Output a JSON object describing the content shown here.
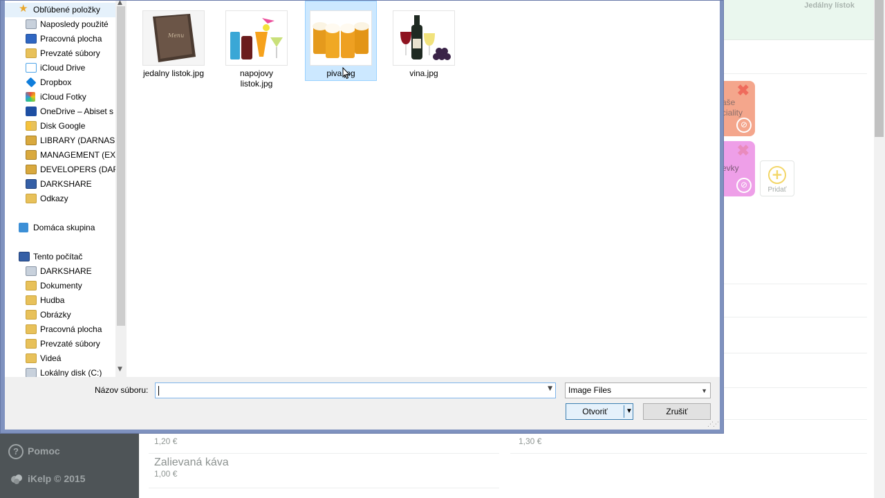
{
  "background_app": {
    "menu_title": "Jedálny lístok",
    "categories": [
      {
        "label": "aše\nciality",
        "color": "#f4a68c"
      },
      {
        "label": "evky",
        "color": "#ee9fe8"
      }
    ],
    "add_label": "Pridať",
    "help_label": "Pomoc",
    "copyright": "iKelp © 2015",
    "items": [
      {
        "name": "",
        "price": "1,20 €"
      },
      {
        "name": "",
        "price": "1,30 €"
      },
      {
        "name": "Zalievaná káva",
        "price": "1,00 €"
      }
    ]
  },
  "dialog": {
    "nav_items": [
      {
        "label": "Obľúbené položky",
        "icon": "star-icon"
      },
      {
        "label": "Naposledy použité",
        "icon": "recent-places-icon"
      },
      {
        "label": "Pracovná plocha",
        "icon": "desktop-icon"
      },
      {
        "label": "Prevzaté súbory",
        "icon": "downloads-folder-icon"
      },
      {
        "label": "iCloud Drive",
        "icon": "icloud-icon"
      },
      {
        "label": "Dropbox",
        "icon": "dropbox-icon"
      },
      {
        "label": "iCloud Fotky",
        "icon": "photos-icon"
      },
      {
        "label": "OneDrive – Abiset s",
        "icon": "onedrive-icon"
      },
      {
        "label": "Disk Google",
        "icon": "google-drive-folder-icon"
      },
      {
        "label": "LIBRARY (DARNASS",
        "icon": "network-folder-icon"
      },
      {
        "label": "MANAGEMENT (EX",
        "icon": "network-folder-icon"
      },
      {
        "label": "DEVELOPERS (DARN",
        "icon": "network-folder-icon"
      },
      {
        "label": "DARKSHARE",
        "icon": "computer-icon"
      },
      {
        "label": "Odkazy",
        "icon": "folder-icon"
      },
      {
        "label": "Domáca skupina",
        "icon": "homegroup-icon"
      },
      {
        "label": "Tento počítač",
        "icon": "this-pc-icon"
      },
      {
        "label": "DARKSHARE",
        "icon": "network-drive-icon"
      },
      {
        "label": "Dokumenty",
        "icon": "documents-folder-icon"
      },
      {
        "label": "Hudba",
        "icon": "music-folder-icon"
      },
      {
        "label": "Obrázky",
        "icon": "pictures-folder-icon"
      },
      {
        "label": "Pracovná plocha",
        "icon": "desktop-folder-icon"
      },
      {
        "label": "Prevzaté súbory",
        "icon": "downloads-folder-icon"
      },
      {
        "label": "Videá",
        "icon": "videos-folder-icon"
      },
      {
        "label": "Lokálny disk (C:)",
        "icon": "local-disk-icon"
      }
    ],
    "files": [
      {
        "name": "jedalny listok.jpg",
        "selected": false
      },
      {
        "name": "napojovy\nlistok.jpg",
        "selected": false
      },
      {
        "name": "piva.jpg",
        "selected": true
      },
      {
        "name": "vina.jpg",
        "selected": false
      }
    ],
    "filename_label": "Názov súboru:",
    "filename_value": "",
    "filetype_value": "Image Files",
    "open_label": "Otvoriť",
    "cancel_label": "Zrušiť"
  }
}
